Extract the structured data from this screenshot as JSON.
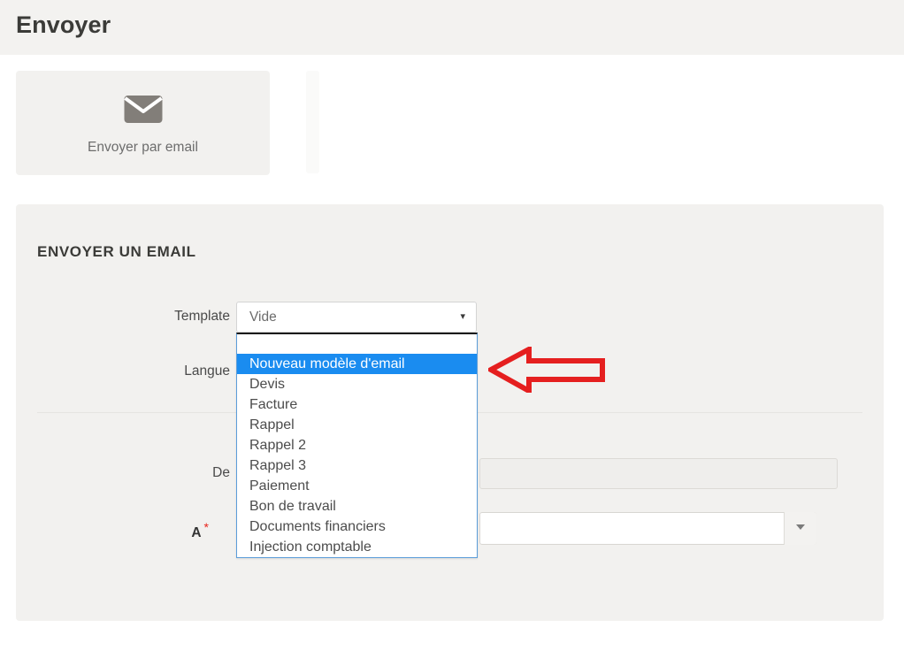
{
  "header": {
    "title": "Envoyer"
  },
  "actions": {
    "email_card": {
      "icon": "envelope-icon",
      "label": "Envoyer par email"
    }
  },
  "form": {
    "section_title": "ENVOYER UN EMAIL",
    "fields": {
      "template": {
        "label": "Template",
        "value": "Vide",
        "caret": "▾"
      },
      "langue": {
        "label": "Langue"
      },
      "de": {
        "label": "De",
        "value": "",
        "disabled": true
      },
      "a": {
        "label": "A",
        "required_marker": "*",
        "value": ""
      }
    },
    "template_options": [
      "",
      "Nouveau modèle d'email",
      "Devis",
      "Facture",
      "Rappel",
      "Rappel 2",
      "Rappel 3",
      "Paiement",
      "Bon de travail",
      "Documents financiers",
      "Injection comptable"
    ],
    "template_selected_index": 1
  },
  "annotation": {
    "arrow": "left-arrow-annotation",
    "color": "#e51f1f"
  },
  "colors": {
    "panel_bg": "#f2f1ef",
    "page_bg": "#ffffff",
    "highlight": "#1a8cf0",
    "required": "#e8231b",
    "icon_gray": "#827e79"
  }
}
